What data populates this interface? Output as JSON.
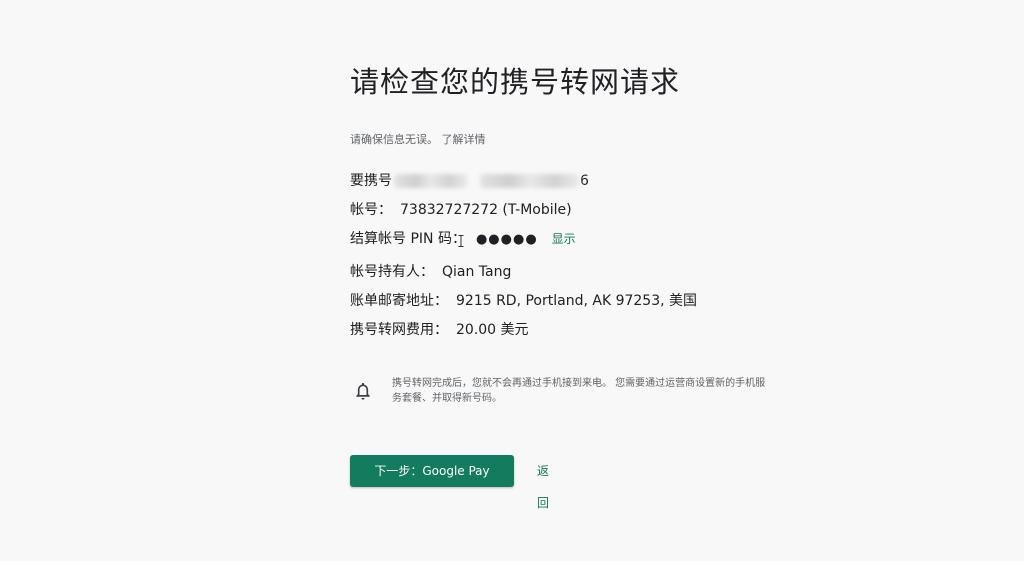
{
  "header": {
    "title": "请检查您的携号转网请求",
    "subtitle": "请确保信息无误。 了解详情"
  },
  "details": {
    "port_number_label": "要携号",
    "port_number_trailing": "6",
    "account_label": "帐号：",
    "account_value": "73832727272 (T-Mobile)",
    "pin_label": "结算帐号 PIN 码：",
    "pin_value": "●●●●●",
    "pin_show": "显示",
    "holder_label": "帐号持有人：",
    "holder_value": "Qian Tang",
    "address_label": "账单邮寄地址：",
    "address_value": "9215 RD, Portland, AK 97253, 美国",
    "fee_label": "携号转网费用：",
    "fee_value": "20.00 美元"
  },
  "notice": {
    "icon": "bell-icon",
    "text": "携号转网完成后，您就不会再通过手机接到来电。 您需要通过运营商设置新的手机服务套餐、并取得新号码。"
  },
  "actions": {
    "next_label": "下一步：Google Pay",
    "back_label": "返回"
  },
  "colors": {
    "accent": "#137b5e",
    "background": "#f8f8f8"
  }
}
